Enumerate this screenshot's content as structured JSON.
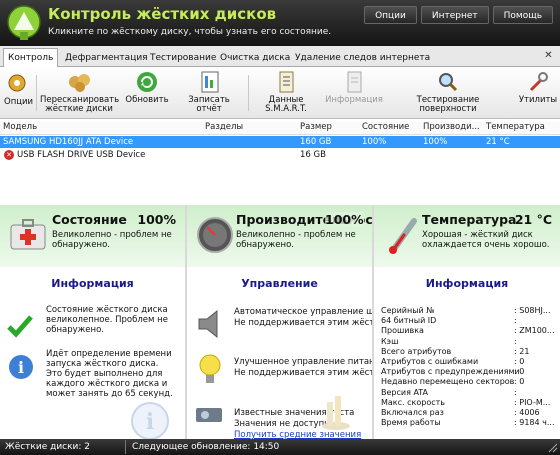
{
  "header": {
    "title": "Контроль жёстких дисков",
    "subtitle": "Кликните по жёсткому диску, чтобы узнать его состояние.",
    "menu": [
      "Опции",
      "Интернет",
      "Помощь"
    ]
  },
  "tabs": [
    {
      "label": "Контроль",
      "active": true
    },
    {
      "label": "Дефрагментация"
    },
    {
      "label": "Тестирование"
    },
    {
      "label": "Очистка диска"
    },
    {
      "label": "Удаление следов интернета"
    }
  ],
  "toolbar": {
    "options": "Опции",
    "rescan": "Пересканировать жёсткие диски",
    "refresh": "Обновить",
    "report": "Записать отчёт",
    "smart": "Данные S.M.A.R.T.",
    "info": "Информация",
    "surface": "Тестирование поверхности",
    "utilities": "Утилиты"
  },
  "devices": {
    "columns": [
      "Модель",
      "Разделы",
      "Размер",
      "Состояние",
      "Производи...",
      "Температура"
    ],
    "rows": [
      {
        "model": "SAMSUNG HD160JJ ATA Device",
        "partitions": "",
        "size": "160 GB",
        "state": "100%",
        "performance": "100%",
        "temp": "21 °C",
        "selected": true
      },
      {
        "model": "USB FLASH DRIVE USB Device",
        "partitions": "",
        "size": "16 GB",
        "state": "",
        "performance": "",
        "temp": "",
        "selected": false
      }
    ]
  },
  "panels": {
    "state": {
      "title": "Состояние",
      "value": "100%",
      "desc": "Великолепно - проблем не обнаружено.",
      "section": "Информация",
      "item1": "Состояние жёсткого диска великолепное. Проблем не обнаружено.",
      "item2": "Идёт определение времени запуска жёсткого диска. Это будет выполнено для каждого жёсткого диска и может занять до 65 секунд."
    },
    "performance": {
      "title": "Производительность",
      "value": "100%",
      "desc": "Великолепно - проблем не обнаружено.",
      "section": "Управление",
      "item1": "Автоматическое управление шумом",
      "item1b": "Не поддерживается этим жёстким",
      "item2": "Улучшенное управление питанием",
      "item2b": "Не поддерживается этим жёстким",
      "item3": "Известные значения теста",
      "item3b": "Значения не доступны.",
      "item3c": "Получить средние значения"
    },
    "temperature": {
      "title": "Температура",
      "value": "21 °C",
      "desc": "Хорошая - жёсткий диск охлаждается очень хорошо.",
      "section": "Информация",
      "rows": [
        {
          "k": "Серийный №",
          "v": ": S08HJ..."
        },
        {
          "k": "64 битный ID",
          "v": ":"
        },
        {
          "k": "Прошивка",
          "v": ": ZM100..."
        },
        {
          "k": "Кэш",
          "v": ":"
        },
        {
          "k": "Всего атрибутов",
          "v": ": 21"
        },
        {
          "k": "Атрибутов с ошибками",
          "v": ": 0"
        },
        {
          "k": "Атрибутов с предупреждениями",
          "v": ": 0"
        },
        {
          "k": "Недавно перемещено секторов",
          "v": ": 0"
        },
        {
          "k": "Версия ATA",
          "v": ":"
        },
        {
          "k": "Макс. скорость",
          "v": ": PIO-M..."
        },
        {
          "k": "Включался раз",
          "v": ": 4006"
        },
        {
          "k": "Время работы",
          "v": ": 9184 ч..."
        }
      ]
    }
  },
  "statusbar": {
    "disks": "Жёсткие диски: 2",
    "update": "Следующее обновление: 14:50"
  },
  "colors": {
    "accent_title": "#c6ec5a",
    "selection": "#3399ff",
    "section": "#1a1a8c"
  }
}
